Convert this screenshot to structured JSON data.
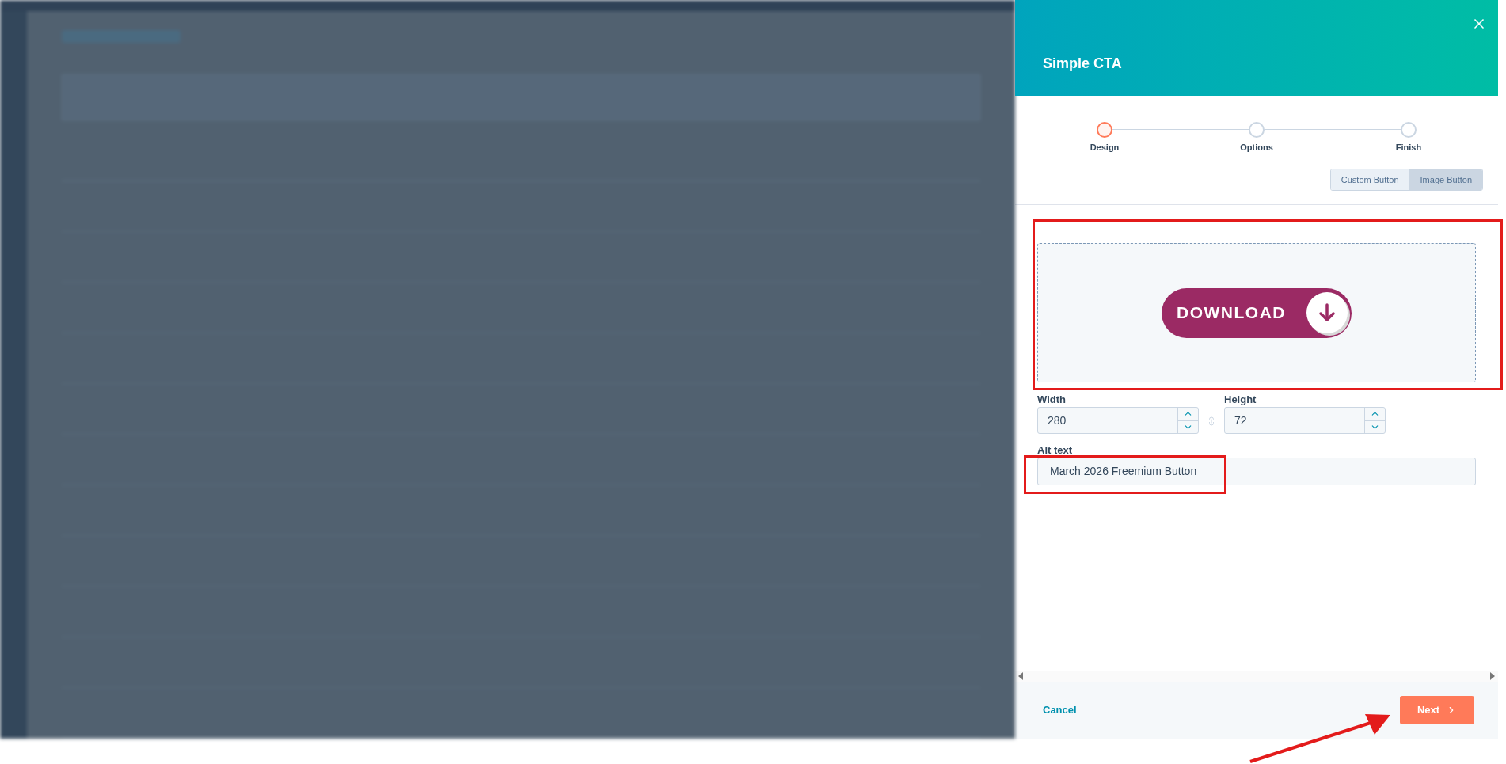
{
  "panel": {
    "title": "Simple CTA",
    "steps": [
      {
        "label": "Design",
        "selected": true
      },
      {
        "label": "Options",
        "selected": false
      },
      {
        "label": "Finish",
        "selected": false
      }
    ],
    "button_types": [
      {
        "label": "Custom Button",
        "selected": false
      },
      {
        "label": "Image Button",
        "selected": true
      }
    ],
    "preview": {
      "image_text": "DOWNLOAD"
    },
    "width": {
      "label": "Width",
      "value": "280"
    },
    "height": {
      "label": "Height",
      "value": "72"
    },
    "alt_text": {
      "label": "Alt text",
      "value": "March 2026 Freemium Button"
    },
    "footer": {
      "cancel": "Cancel",
      "next": "Next"
    }
  }
}
